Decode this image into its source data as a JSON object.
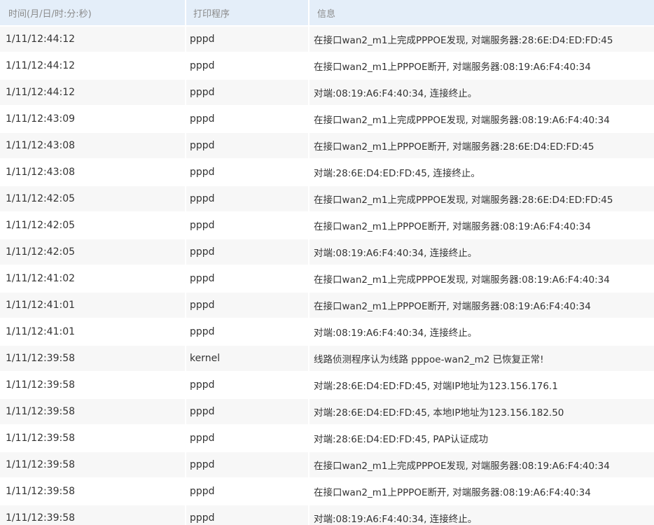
{
  "headers": {
    "time": "时间(月/日/时:分:秒)",
    "program": "打印程序",
    "info": "信息"
  },
  "rows": [
    {
      "time": "1/11/12:44:12",
      "program": "pppd",
      "info": "在接口wan2_m1上完成PPPOE发现, 对端服务器:28:6E:D4:ED:FD:45"
    },
    {
      "time": "1/11/12:44:12",
      "program": "pppd",
      "info": "在接口wan2_m1上PPPOE断开, 对端服务器:08:19:A6:F4:40:34"
    },
    {
      "time": "1/11/12:44:12",
      "program": "pppd",
      "info": "对端:08:19:A6:F4:40:34, 连接终止。"
    },
    {
      "time": "1/11/12:43:09",
      "program": "pppd",
      "info": "在接口wan2_m1上完成PPPOE发现, 对端服务器:08:19:A6:F4:40:34"
    },
    {
      "time": "1/11/12:43:08",
      "program": "pppd",
      "info": "在接口wan2_m1上PPPOE断开, 对端服务器:28:6E:D4:ED:FD:45"
    },
    {
      "time": "1/11/12:43:08",
      "program": "pppd",
      "info": "对端:28:6E:D4:ED:FD:45, 连接终止。"
    },
    {
      "time": "1/11/12:42:05",
      "program": "pppd",
      "info": "在接口wan2_m1上完成PPPOE发现, 对端服务器:28:6E:D4:ED:FD:45"
    },
    {
      "time": "1/11/12:42:05",
      "program": "pppd",
      "info": "在接口wan2_m1上PPPOE断开, 对端服务器:08:19:A6:F4:40:34"
    },
    {
      "time": "1/11/12:42:05",
      "program": "pppd",
      "info": "对端:08:19:A6:F4:40:34, 连接终止。"
    },
    {
      "time": "1/11/12:41:02",
      "program": "pppd",
      "info": "在接口wan2_m1上完成PPPOE发现, 对端服务器:08:19:A6:F4:40:34"
    },
    {
      "time": "1/11/12:41:01",
      "program": "pppd",
      "info": "在接口wan2_m1上PPPOE断开, 对端服务器:08:19:A6:F4:40:34"
    },
    {
      "time": "1/11/12:41:01",
      "program": "pppd",
      "info": "对端:08:19:A6:F4:40:34, 连接终止。"
    },
    {
      "time": "1/11/12:39:58",
      "program": "kernel",
      "info": "线路侦测程序认为线路 pppoe-wan2_m2 已恢复正常!"
    },
    {
      "time": "1/11/12:39:58",
      "program": "pppd",
      "info": "对端:28:6E:D4:ED:FD:45, 对端IP地址为123.156.176.1"
    },
    {
      "time": "1/11/12:39:58",
      "program": "pppd",
      "info": "对端:28:6E:D4:ED:FD:45, 本地IP地址为123.156.182.50"
    },
    {
      "time": "1/11/12:39:58",
      "program": "pppd",
      "info": "对端:28:6E:D4:ED:FD:45, PAP认证成功"
    },
    {
      "time": "1/11/12:39:58",
      "program": "pppd",
      "info": "在接口wan2_m1上完成PPPOE发现, 对端服务器:08:19:A6:F4:40:34"
    },
    {
      "time": "1/11/12:39:58",
      "program": "pppd",
      "info": "在接口wan2_m1上PPPOE断开, 对端服务器:08:19:A6:F4:40:34"
    },
    {
      "time": "1/11/12:39:58",
      "program": "pppd",
      "info": "对端:08:19:A6:F4:40:34, 连接终止。"
    }
  ]
}
